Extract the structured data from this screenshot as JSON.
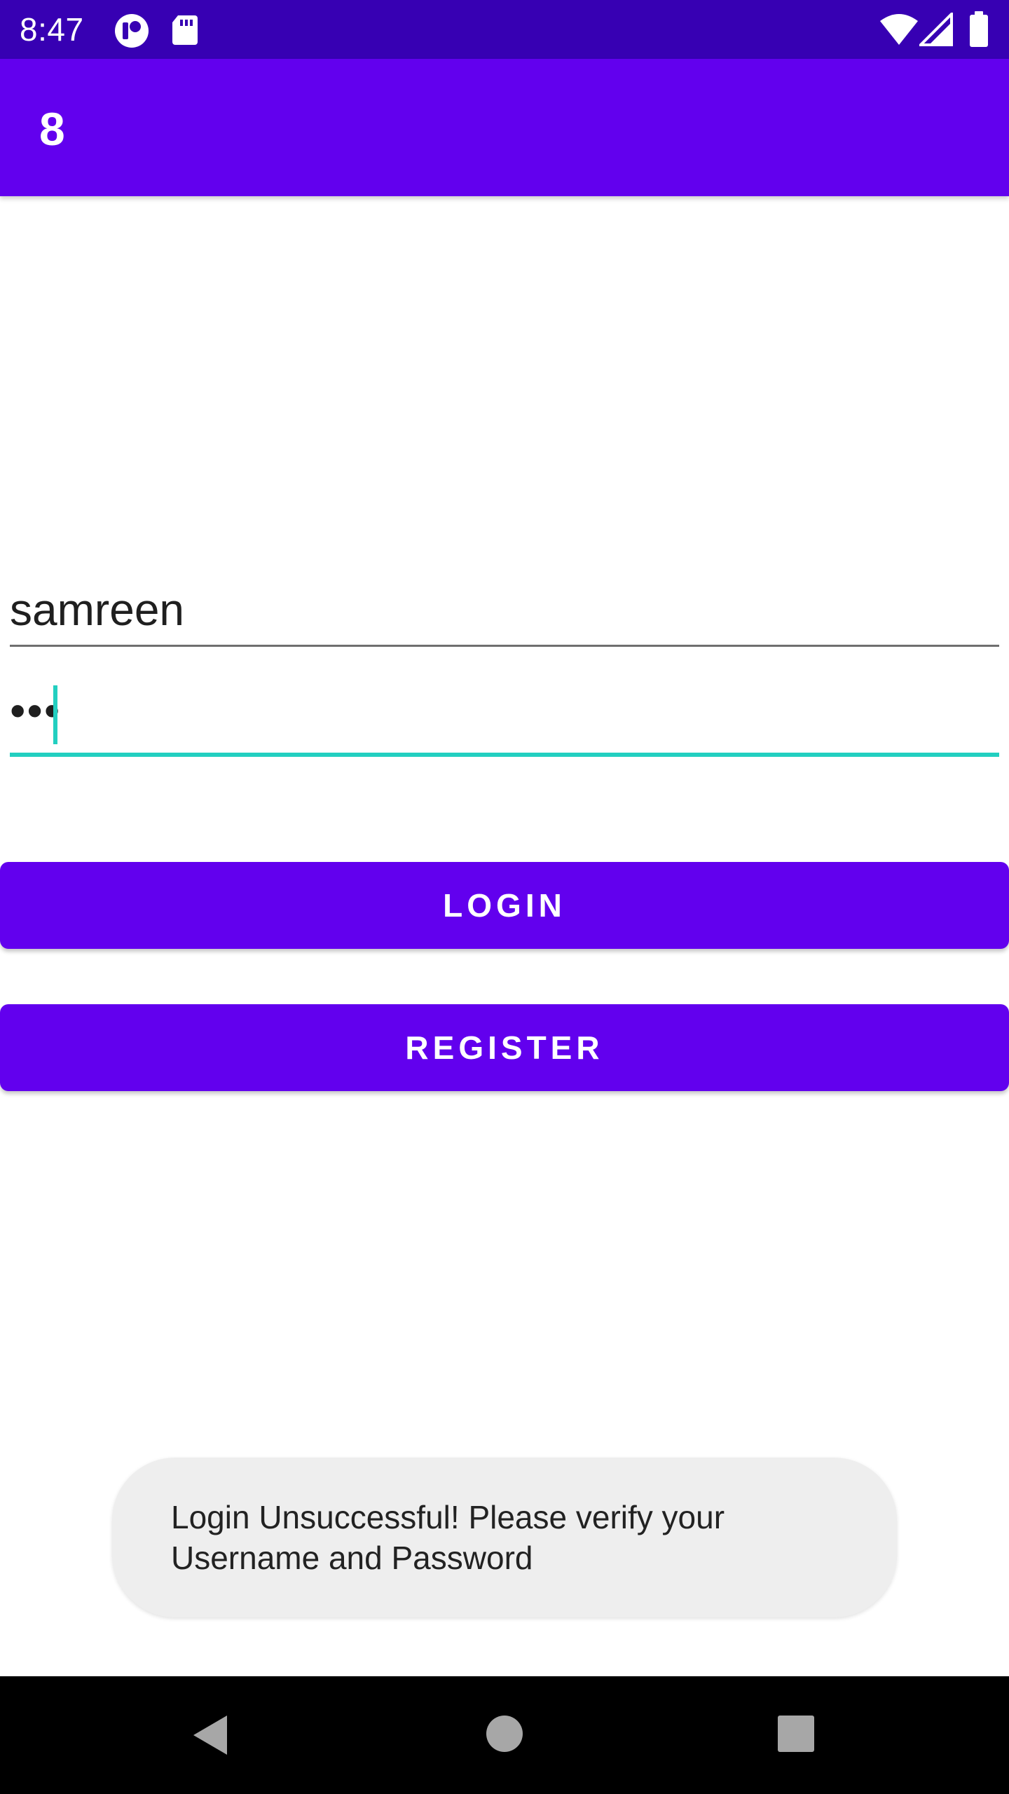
{
  "status_bar": {
    "time": "8:47",
    "icons": [
      "notification-icon",
      "sd-card-icon",
      "wifi-icon",
      "cellular-signal-icon",
      "battery-icon"
    ],
    "background": "#3700b3"
  },
  "app_bar": {
    "title": "8",
    "background": "#6200ee"
  },
  "login_form": {
    "username_value": "samreen",
    "password_value": "•••",
    "focus_color": "#22cfc0"
  },
  "buttons": {
    "login_label": "LOGIN",
    "register_label": "REGISTER",
    "color": "#6200ee"
  },
  "toast": {
    "message": "Login Unsuccessful! Please verify your Username and Password"
  },
  "nav_bar": {
    "icons": [
      "back-icon",
      "home-icon",
      "recents-icon"
    ]
  }
}
